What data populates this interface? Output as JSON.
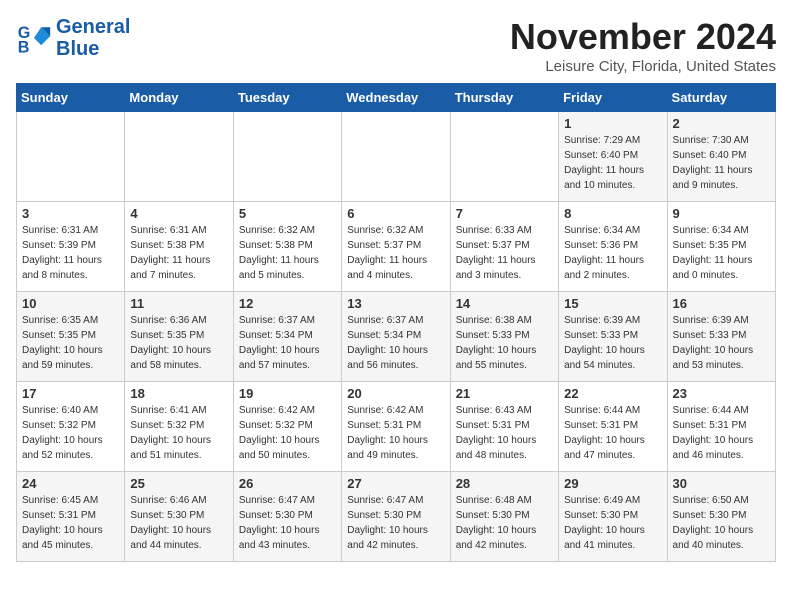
{
  "logo": {
    "line1": "General",
    "line2": "Blue"
  },
  "title": "November 2024",
  "subtitle": "Leisure City, Florida, United States",
  "weekdays": [
    "Sunday",
    "Monday",
    "Tuesday",
    "Wednesday",
    "Thursday",
    "Friday",
    "Saturday"
  ],
  "weeks": [
    [
      {
        "day": "",
        "info": ""
      },
      {
        "day": "",
        "info": ""
      },
      {
        "day": "",
        "info": ""
      },
      {
        "day": "",
        "info": ""
      },
      {
        "day": "",
        "info": ""
      },
      {
        "day": "1",
        "info": "Sunrise: 7:29 AM\nSunset: 6:40 PM\nDaylight: 11 hours\nand 10 minutes."
      },
      {
        "day": "2",
        "info": "Sunrise: 7:30 AM\nSunset: 6:40 PM\nDaylight: 11 hours\nand 9 minutes."
      }
    ],
    [
      {
        "day": "3",
        "info": "Sunrise: 6:31 AM\nSunset: 5:39 PM\nDaylight: 11 hours\nand 8 minutes."
      },
      {
        "day": "4",
        "info": "Sunrise: 6:31 AM\nSunset: 5:38 PM\nDaylight: 11 hours\nand 7 minutes."
      },
      {
        "day": "5",
        "info": "Sunrise: 6:32 AM\nSunset: 5:38 PM\nDaylight: 11 hours\nand 5 minutes."
      },
      {
        "day": "6",
        "info": "Sunrise: 6:32 AM\nSunset: 5:37 PM\nDaylight: 11 hours\nand 4 minutes."
      },
      {
        "day": "7",
        "info": "Sunrise: 6:33 AM\nSunset: 5:37 PM\nDaylight: 11 hours\nand 3 minutes."
      },
      {
        "day": "8",
        "info": "Sunrise: 6:34 AM\nSunset: 5:36 PM\nDaylight: 11 hours\nand 2 minutes."
      },
      {
        "day": "9",
        "info": "Sunrise: 6:34 AM\nSunset: 5:35 PM\nDaylight: 11 hours\nand 0 minutes."
      }
    ],
    [
      {
        "day": "10",
        "info": "Sunrise: 6:35 AM\nSunset: 5:35 PM\nDaylight: 10 hours\nand 59 minutes."
      },
      {
        "day": "11",
        "info": "Sunrise: 6:36 AM\nSunset: 5:35 PM\nDaylight: 10 hours\nand 58 minutes."
      },
      {
        "day": "12",
        "info": "Sunrise: 6:37 AM\nSunset: 5:34 PM\nDaylight: 10 hours\nand 57 minutes."
      },
      {
        "day": "13",
        "info": "Sunrise: 6:37 AM\nSunset: 5:34 PM\nDaylight: 10 hours\nand 56 minutes."
      },
      {
        "day": "14",
        "info": "Sunrise: 6:38 AM\nSunset: 5:33 PM\nDaylight: 10 hours\nand 55 minutes."
      },
      {
        "day": "15",
        "info": "Sunrise: 6:39 AM\nSunset: 5:33 PM\nDaylight: 10 hours\nand 54 minutes."
      },
      {
        "day": "16",
        "info": "Sunrise: 6:39 AM\nSunset: 5:33 PM\nDaylight: 10 hours\nand 53 minutes."
      }
    ],
    [
      {
        "day": "17",
        "info": "Sunrise: 6:40 AM\nSunset: 5:32 PM\nDaylight: 10 hours\nand 52 minutes."
      },
      {
        "day": "18",
        "info": "Sunrise: 6:41 AM\nSunset: 5:32 PM\nDaylight: 10 hours\nand 51 minutes."
      },
      {
        "day": "19",
        "info": "Sunrise: 6:42 AM\nSunset: 5:32 PM\nDaylight: 10 hours\nand 50 minutes."
      },
      {
        "day": "20",
        "info": "Sunrise: 6:42 AM\nSunset: 5:31 PM\nDaylight: 10 hours\nand 49 minutes."
      },
      {
        "day": "21",
        "info": "Sunrise: 6:43 AM\nSunset: 5:31 PM\nDaylight: 10 hours\nand 48 minutes."
      },
      {
        "day": "22",
        "info": "Sunrise: 6:44 AM\nSunset: 5:31 PM\nDaylight: 10 hours\nand 47 minutes."
      },
      {
        "day": "23",
        "info": "Sunrise: 6:44 AM\nSunset: 5:31 PM\nDaylight: 10 hours\nand 46 minutes."
      }
    ],
    [
      {
        "day": "24",
        "info": "Sunrise: 6:45 AM\nSunset: 5:31 PM\nDaylight: 10 hours\nand 45 minutes."
      },
      {
        "day": "25",
        "info": "Sunrise: 6:46 AM\nSunset: 5:30 PM\nDaylight: 10 hours\nand 44 minutes."
      },
      {
        "day": "26",
        "info": "Sunrise: 6:47 AM\nSunset: 5:30 PM\nDaylight: 10 hours\nand 43 minutes."
      },
      {
        "day": "27",
        "info": "Sunrise: 6:47 AM\nSunset: 5:30 PM\nDaylight: 10 hours\nand 42 minutes."
      },
      {
        "day": "28",
        "info": "Sunrise: 6:48 AM\nSunset: 5:30 PM\nDaylight: 10 hours\nand 42 minutes."
      },
      {
        "day": "29",
        "info": "Sunrise: 6:49 AM\nSunset: 5:30 PM\nDaylight: 10 hours\nand 41 minutes."
      },
      {
        "day": "30",
        "info": "Sunrise: 6:50 AM\nSunset: 5:30 PM\nDaylight: 10 hours\nand 40 minutes."
      }
    ]
  ]
}
